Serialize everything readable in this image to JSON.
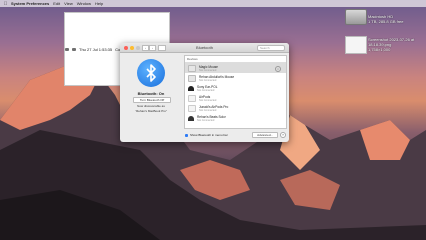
{
  "menubar": {
    "app_name": "System Preferences",
    "menus": [
      "Edit",
      "View",
      "Window",
      "Help"
    ],
    "clock": "Thu 27 Jul 1:53:35",
    "user": "Computer@Scientist"
  },
  "desktop": {
    "hd_label": "Macintosh HD\n1 TB, 285.8 GB free",
    "screenshot_label": "Screenshot 2023-07-26 at 18.18.39.png\n1,758×1,000"
  },
  "window": {
    "title": "Bluetooth",
    "search_placeholder": "Search"
  },
  "bluetooth": {
    "status": "Bluetooth: On",
    "toggle_label": "Turn Bluetooth Off",
    "discoverable_label": "Now discoverable as",
    "device_name": "“Rehan's MacBook Pro”"
  },
  "devices": {
    "header": "Devices",
    "items": [
      {
        "name": "Magic Mouse",
        "status": "Not Connected",
        "selected": true
      },
      {
        "name": "Rehan Abdullah's Mouse",
        "status": "Not Connected",
        "selected": false
      },
      {
        "name": "Sony Ear-POL",
        "status": "Not Connected",
        "selected": false
      },
      {
        "name": "AirPods",
        "status": "Not Connected",
        "selected": false
      },
      {
        "name": "Junaid's AirPods Pro",
        "status": "Not Connected",
        "selected": false
      },
      {
        "name": "Rehan's Beats Solo³",
        "status": "Not Connected",
        "selected": false
      }
    ]
  },
  "footer": {
    "show_in_menubar": "Show Bluetooth in menu bar",
    "advanced": "Advanced...",
    "help": "?"
  },
  "colors": {
    "accent": "#2e7bf6",
    "bluetooth_blue": "#1a6fdc"
  }
}
